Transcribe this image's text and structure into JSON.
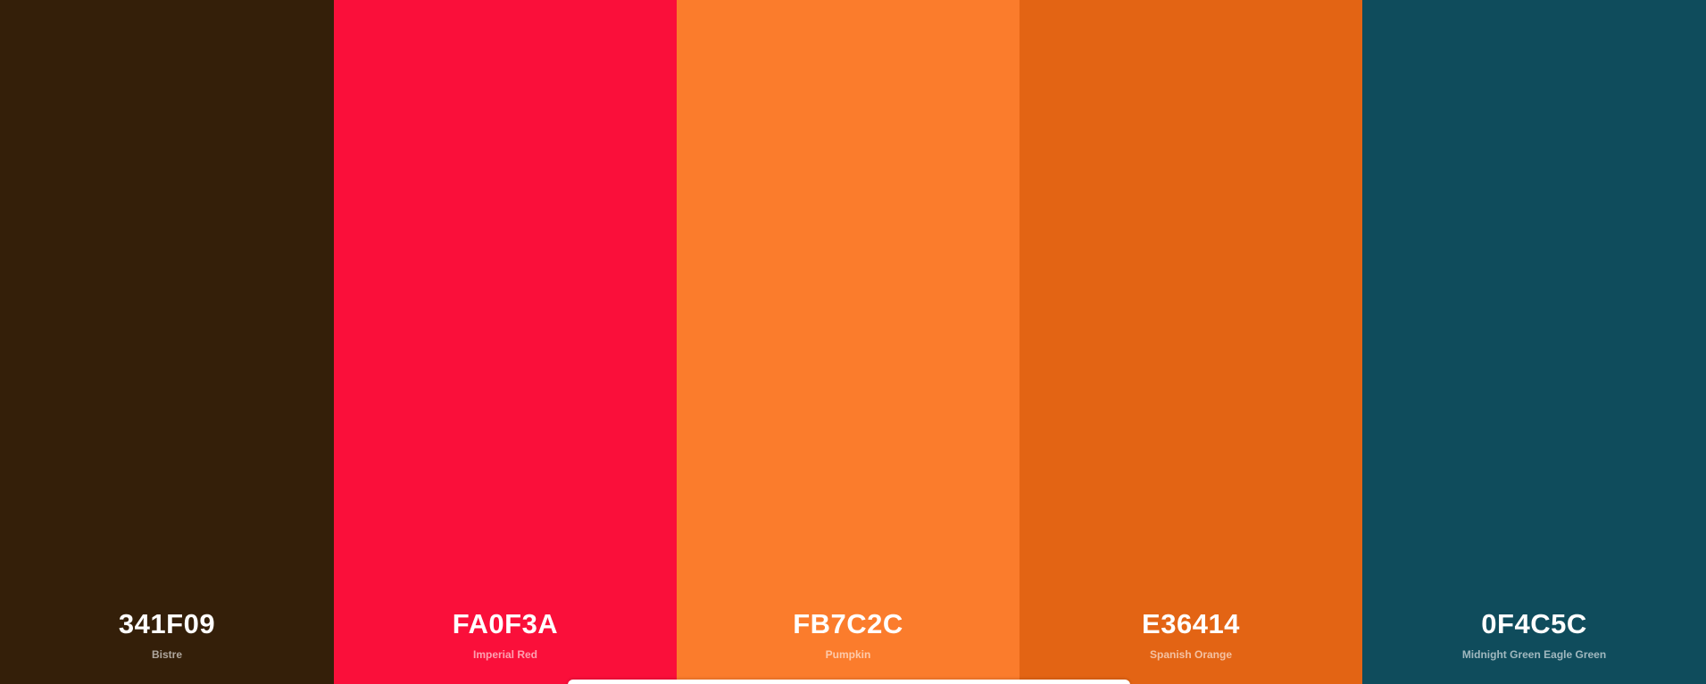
{
  "palette": {
    "colors": [
      {
        "hex": "341F09",
        "name": "Bistre",
        "color": "#341F09"
      },
      {
        "hex": "FA0F3A",
        "name": "Imperial Red",
        "color": "#FA0F3A"
      },
      {
        "hex": "FB7C2C",
        "name": "Pumpkin",
        "color": "#FB7C2C"
      },
      {
        "hex": "E36414",
        "name": "Spanish Orange",
        "color": "#E36414"
      },
      {
        "hex": "0F4C5C",
        "name": "Midnight Green Eagle Green",
        "color": "#0F4C5C"
      }
    ]
  }
}
